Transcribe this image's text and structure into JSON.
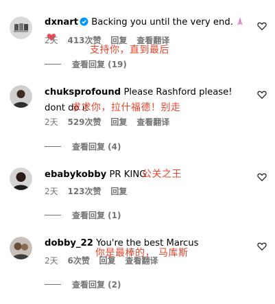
{
  "comments": [
    {
      "username": "dxnart",
      "text": "Backing you until the very end.",
      "time": "2天",
      "likes": "413次赞",
      "reply": "回复",
      "translate": "查看翻译",
      "translation": "支持你，直到最后",
      "view_replies": "查看回复 (19)",
      "verified": true
    },
    {
      "username": "chuksprofound",
      "text": "Please Rashford please! dont do it",
      "time": "2天",
      "likes": "529次赞",
      "reply": "回复",
      "translate": "查看翻译",
      "translation": "求求你，拉什福德！别走",
      "view_replies": "查看回复 (4)"
    },
    {
      "username": "ebabykobby",
      "text": "PR KING",
      "time": "2天",
      "likes": "123次赞",
      "reply": "回复",
      "translation": "公关之王",
      "view_replies": "查看回复 (1)"
    },
    {
      "username": "dobby_22",
      "text": "You're the best Marcus",
      "time": "2天",
      "likes": "6次赞",
      "reply": "回复",
      "translate": "查看翻译",
      "translation": "你是最棒的， 马库斯",
      "view_replies": "查看回复 (2)"
    }
  ],
  "colors": {
    "meta": "#737373",
    "annotation": "#e8452c",
    "verified": "#0095f6",
    "heart_emoji": "#ed4956"
  },
  "icons": [
    "verified-badge-icon",
    "praying-hands-emoji",
    "red-heart-emoji",
    "like-heart-icon"
  ]
}
